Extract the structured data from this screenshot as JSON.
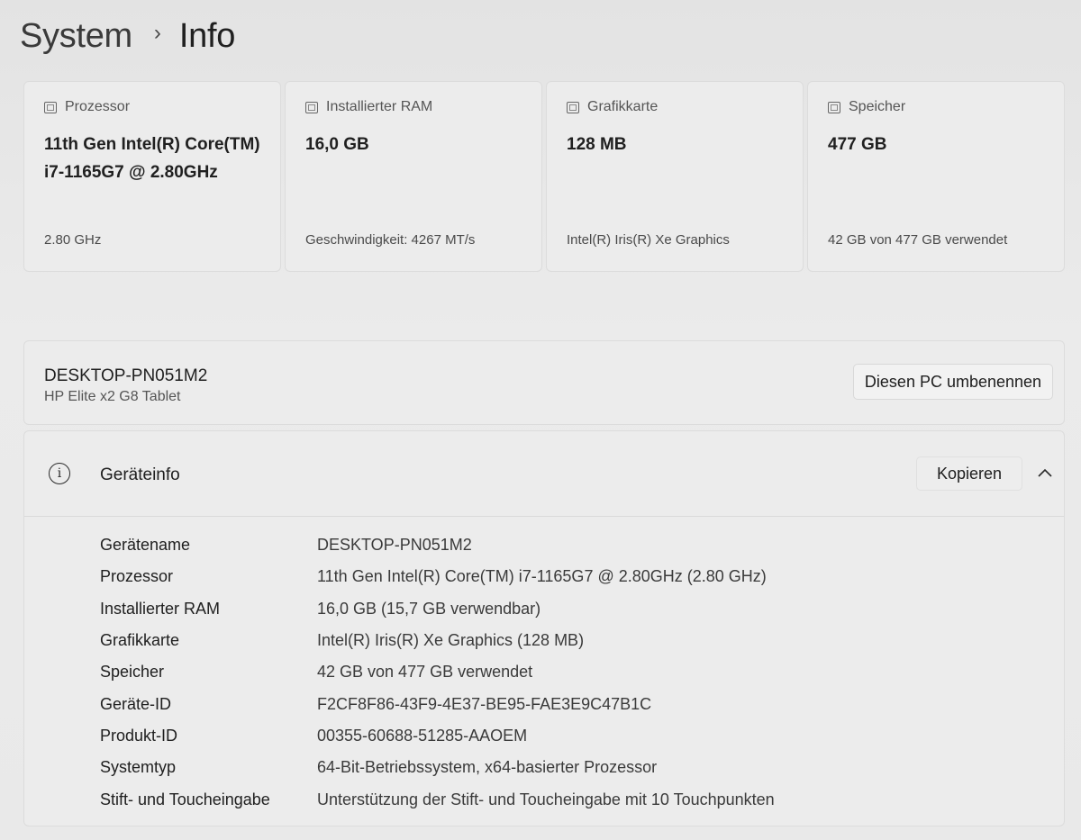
{
  "breadcrumb": {
    "parent": "System",
    "separator": "›",
    "current": "Info"
  },
  "cards": [
    {
      "icon": "cpu-icon",
      "label": "Prozessor",
      "value": "11th Gen Intel(R) Core(TM) i7-1165G7 @ 2.80GHz",
      "sub": "2.80 GHz"
    },
    {
      "icon": "ram-icon",
      "label": "Installierter RAM",
      "value": "16,0 GB",
      "sub": "Geschwindigkeit: 4267 MT/s"
    },
    {
      "icon": "gpu-icon",
      "label": "Grafikkarte",
      "value": "128 MB",
      "sub": "Intel(R) Iris(R) Xe Graphics"
    },
    {
      "icon": "storage-icon",
      "label": "Speicher",
      "value": "477 GB",
      "sub": "42 GB von 477 GB verwendet"
    }
  ],
  "device": {
    "name": "DESKTOP-PN051M2",
    "model": "HP Elite x2 G8 Tablet",
    "rename_label": "Diesen PC umbenennen"
  },
  "info": {
    "title": "Geräteinfo",
    "copy_label": "Kopieren",
    "rows": [
      {
        "key": "Gerätename",
        "value": "DESKTOP-PN051M2"
      },
      {
        "key": "Prozessor",
        "value": "11th Gen Intel(R) Core(TM) i7-1165G7 @ 2.80GHz (2.80 GHz)"
      },
      {
        "key": "Installierter RAM",
        "value": "16,0 GB (15,7 GB verwendbar)"
      },
      {
        "key": "Grafikkarte",
        "value": "Intel(R) Iris(R) Xe Graphics (128 MB)"
      },
      {
        "key": "Speicher",
        "value": "42 GB von 477 GB verwendet"
      },
      {
        "key": "Geräte-ID",
        "value": "F2CF8F86-43F9-4E37-BE95-FAE3E9C47B1C"
      },
      {
        "key": "Produkt-ID",
        "value": "00355-60688-51285-AAOEM"
      },
      {
        "key": "Systemtyp",
        "value": "64-Bit-Betriebssystem, x64-basierter Prozessor"
      },
      {
        "key": "Stift- und Toucheingabe",
        "value": "Unterstützung der Stift- und Toucheingabe mit 10 Touchpunkten"
      }
    ]
  }
}
